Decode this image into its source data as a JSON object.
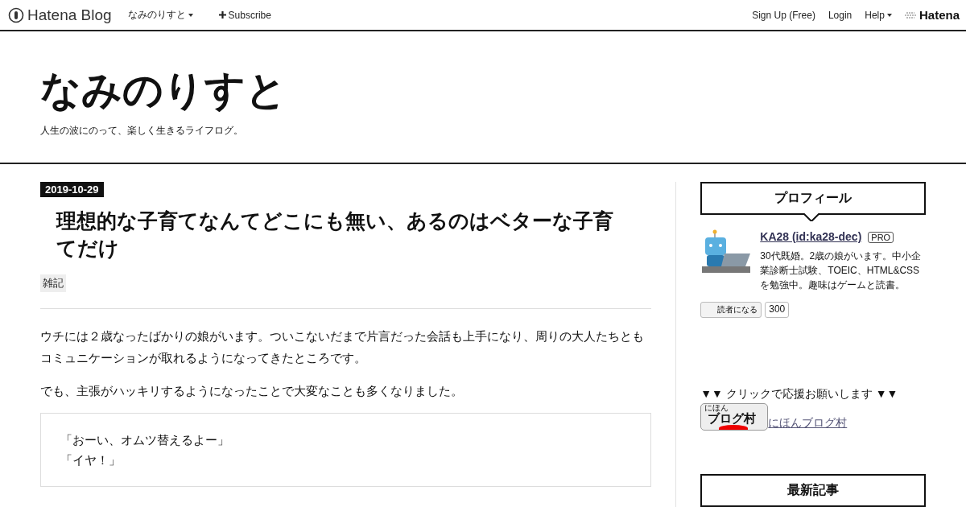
{
  "topbar": {
    "logo": "Hatena Blog",
    "blog_menu": "なみのりすと",
    "subscribe": "Subscribe",
    "links": [
      "Sign Up (Free)",
      "Login"
    ],
    "help": "Help",
    "brand": "Hatena"
  },
  "header": {
    "title": "なみのりすと",
    "tagline": "人生の波にのって、楽しく生きるライフログ。"
  },
  "article": {
    "date": "2019-10-29",
    "title": "理想的な子育てなんてどこにも無い、あるのはベターな子育てだけ",
    "category": "雑記",
    "paragraphs": [
      "ウチには２歳なったばかりの娘がいます。ついこないだまで片言だった会話も上手になり、周りの大人たちともコミュニケーションが取れるようになってきたところです。",
      "でも、主張がハッキリするようになったことで大変なことも多くなりました。"
    ],
    "quote": [
      "「おーい、オムツ替えるよー」",
      "「イヤ！」"
    ]
  },
  "sidebar": {
    "profile": {
      "heading": "プロフィール",
      "name": "KA28 (id:ka28-dec)",
      "badge": "PRO",
      "bio": "30代既婚。2歳の娘がいます。中小企業診断士試験、TOEIC、HTML&CSSを勉強中。趣味はゲームと読書。",
      "follow": "読者になる",
      "count": "300"
    },
    "support": {
      "text": "▼▼ クリックで応援お願いします ▼▼",
      "banner_small": "にほん",
      "banner": "ブログ村",
      "link": "にほんブログ村"
    },
    "recent": {
      "heading": "最新記事"
    }
  }
}
